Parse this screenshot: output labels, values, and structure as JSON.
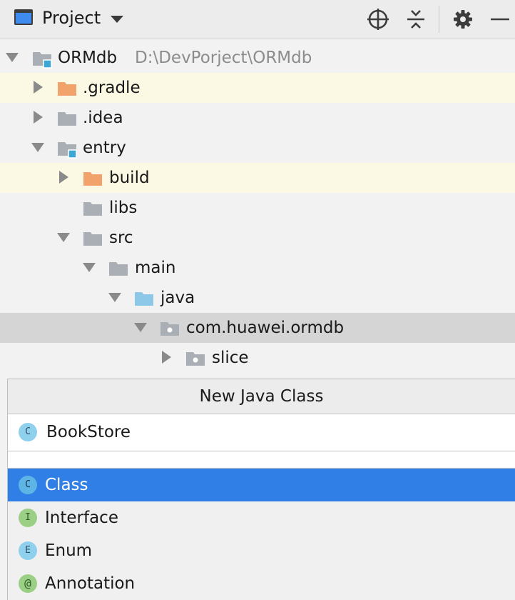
{
  "toolbar": {
    "title": "Project",
    "buttons": [
      {
        "icon": "locate-target-icon"
      },
      {
        "icon": "collapse-all-icon"
      },
      {
        "icon": "gear-icon"
      },
      {
        "icon": "minimize-icon"
      }
    ]
  },
  "tree": {
    "root": {
      "label": "ORMdb",
      "path": "D:\\DevPorject\\ORMdb"
    },
    "items": [
      {
        "label": ".gradle"
      },
      {
        "label": ".idea"
      },
      {
        "label": "entry"
      },
      {
        "label": "build"
      },
      {
        "label": "libs"
      },
      {
        "label": "src"
      },
      {
        "label": "main"
      },
      {
        "label": "java"
      },
      {
        "label": "com.huawei.ormdb"
      },
      {
        "label": "slice"
      }
    ]
  },
  "popup": {
    "title": "New Java Class",
    "input_value": "BookStore",
    "input_badge": "C",
    "kinds": [
      {
        "badge": "C",
        "label": "Class",
        "selected": true
      },
      {
        "badge": "I",
        "label": "Interface",
        "selected": false
      },
      {
        "badge": "E",
        "label": "Enum",
        "selected": false
      },
      {
        "badge": "@",
        "label": "Annotation",
        "selected": false
      }
    ]
  },
  "colors": {
    "selection": "#2f7fe6",
    "excluded_folder": "#f2a36c",
    "source_folder": "#8dc8e8",
    "folder": "#a9afb5",
    "module_badge": "#3aa7d4"
  }
}
